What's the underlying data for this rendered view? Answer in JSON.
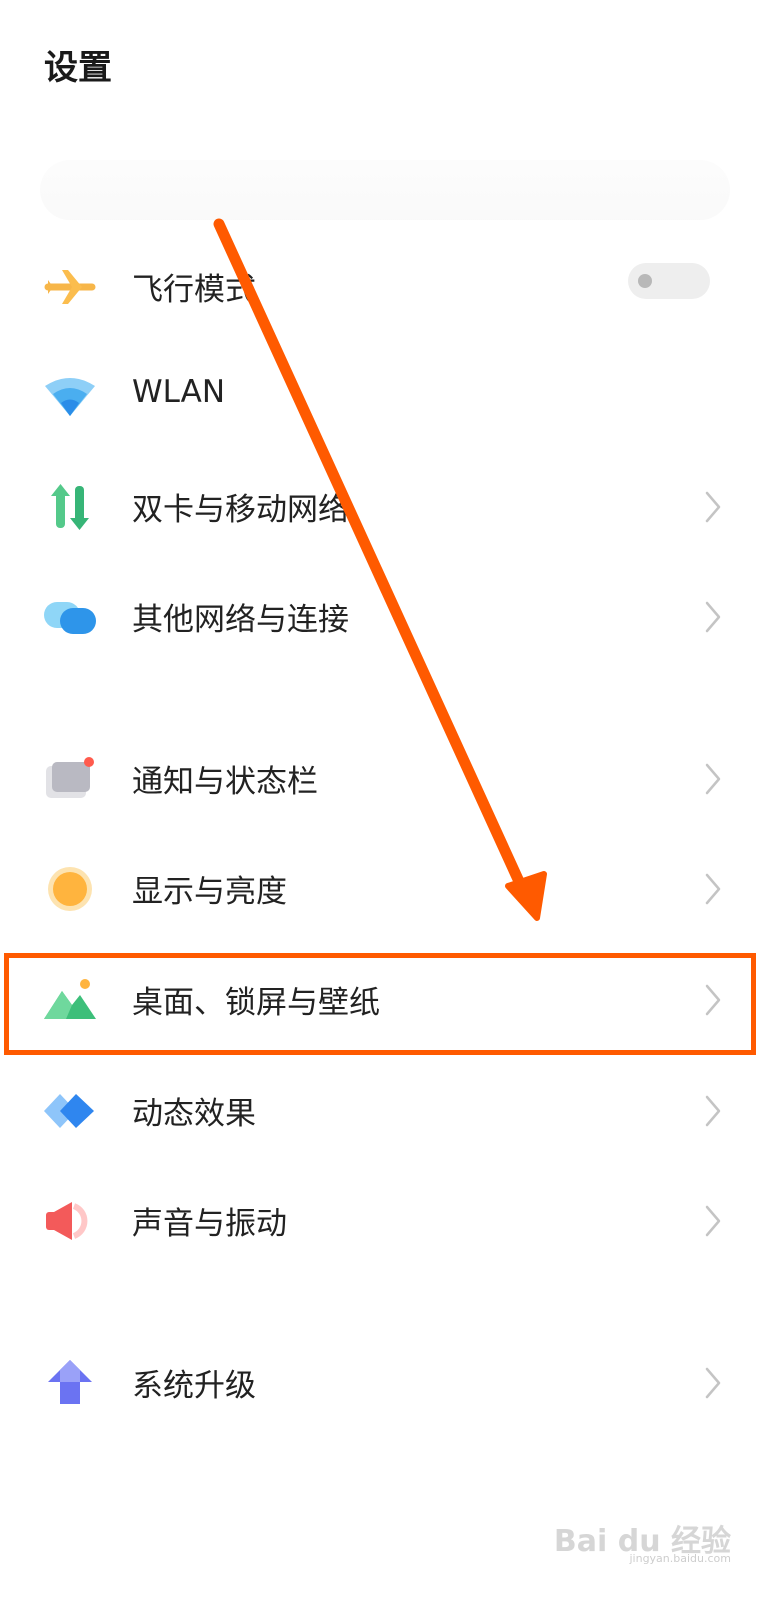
{
  "header": {
    "title": "设置"
  },
  "items": [
    {
      "label": "飞行模式",
      "icon": "airplane-icon",
      "toggle": "off"
    },
    {
      "label": "WLAN",
      "icon": "wifi-icon"
    },
    {
      "label": "双卡与移动网络",
      "icon": "mobile-data-icon"
    },
    {
      "label": "其他网络与连接",
      "icon": "connections-icon"
    },
    {
      "label": "通知与状态栏",
      "icon": "notification-icon"
    },
    {
      "label": "显示与亮度",
      "icon": "brightness-icon"
    },
    {
      "label": "桌面、锁屏与壁纸",
      "icon": "wallpaper-icon"
    },
    {
      "label": "动态效果",
      "icon": "dynamic-effects-icon"
    },
    {
      "label": "声音与振动",
      "icon": "sound-icon"
    },
    {
      "label": "系统升级",
      "icon": "system-update-icon"
    }
  ],
  "annotation": {
    "color": "#ff5a00",
    "highlighted_item": "桌面、锁屏与壁纸"
  },
  "watermark": {
    "text": "Bai du 经验",
    "sub": "jingyan.baidu.com"
  }
}
